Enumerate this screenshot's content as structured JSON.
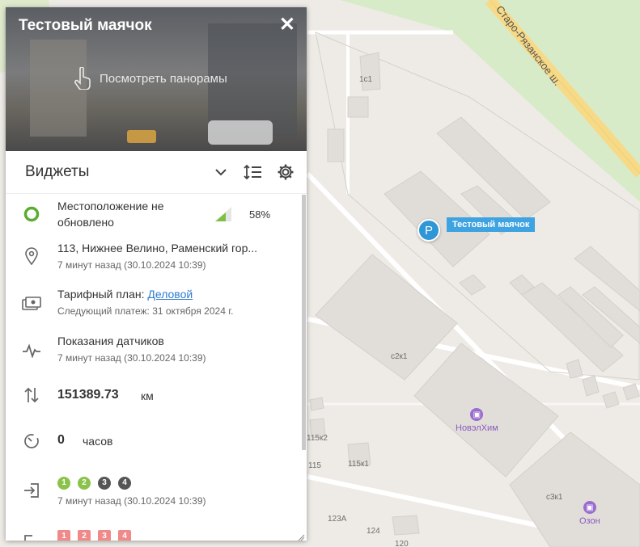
{
  "panel": {
    "title": "Тестовый маячок",
    "close": "✕",
    "panorama_label": "Посмотреть панорамы",
    "widgets_title": "Виджеты"
  },
  "widgets": {
    "location_status": "Местоположение не обновлено",
    "signal_percent": "58%",
    "address": "113, Нижнее Велино, Раменский гор...",
    "address_time": "7 минут назад (30.10.2024 10:39)",
    "tariff_label": "Тарифный план:",
    "tariff_name": "Деловой",
    "next_payment": "Следующий платеж: 31 октября 2024 г.",
    "sensors_label": "Показания датчиков",
    "sensors_time": "7 минут назад (30.10.2024 10:39)",
    "mileage_value": "151389.73",
    "mileage_unit": "км",
    "hours_value": "0",
    "hours_unit": "часов",
    "inputs": [
      "1",
      "2",
      "3",
      "4"
    ],
    "inputs_time": "7 минут назад (30.10.2024 10:39)",
    "outputs": [
      "1",
      "2",
      "3",
      "4"
    ]
  },
  "map": {
    "marker_letter": "P",
    "marker_label": "Тестовый маячок",
    "road": "Старо-Рязанское ш.",
    "labels": [
      "1с1",
      "с2к1",
      "115к2",
      "115",
      "115к1",
      "123А",
      "124",
      "120",
      "с3к1"
    ],
    "poi": [
      {
        "name": "НовэлХим"
      },
      {
        "name": "Озон"
      }
    ]
  },
  "colors": {
    "accent": "#2f96d8",
    "status_ring": "#5aad2e",
    "badge_green": "#8bc34a",
    "badge_dark": "#555555",
    "badge_red": "#f08a8a"
  }
}
